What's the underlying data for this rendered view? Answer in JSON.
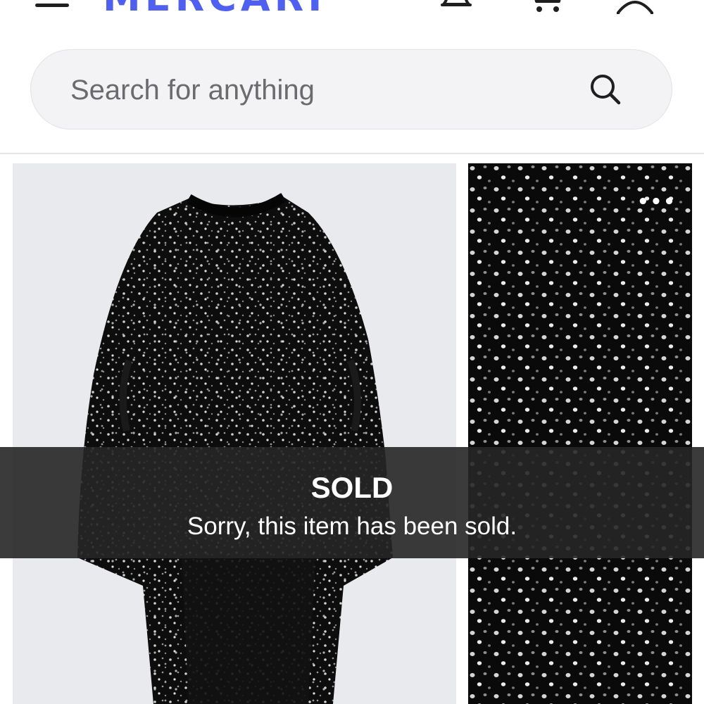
{
  "header": {
    "logo": "MERCARI",
    "brand_color": "#4f5ff0",
    "icons": [
      "menu-icon",
      "bell-icon",
      "cart-icon",
      "user-icon"
    ]
  },
  "search": {
    "placeholder": "Search for anything",
    "icon": "search-icon"
  },
  "listing": {
    "photos": [
      "main-photo",
      "detail-photo"
    ],
    "more_icon": "more-dots-icon",
    "sold_title": "SOLD",
    "sold_message": "Sorry, this item has been sold."
  },
  "colors": {
    "overlay": "#262626",
    "overlay_text": "#ffffff",
    "search_bg": "#f3f3f5"
  }
}
